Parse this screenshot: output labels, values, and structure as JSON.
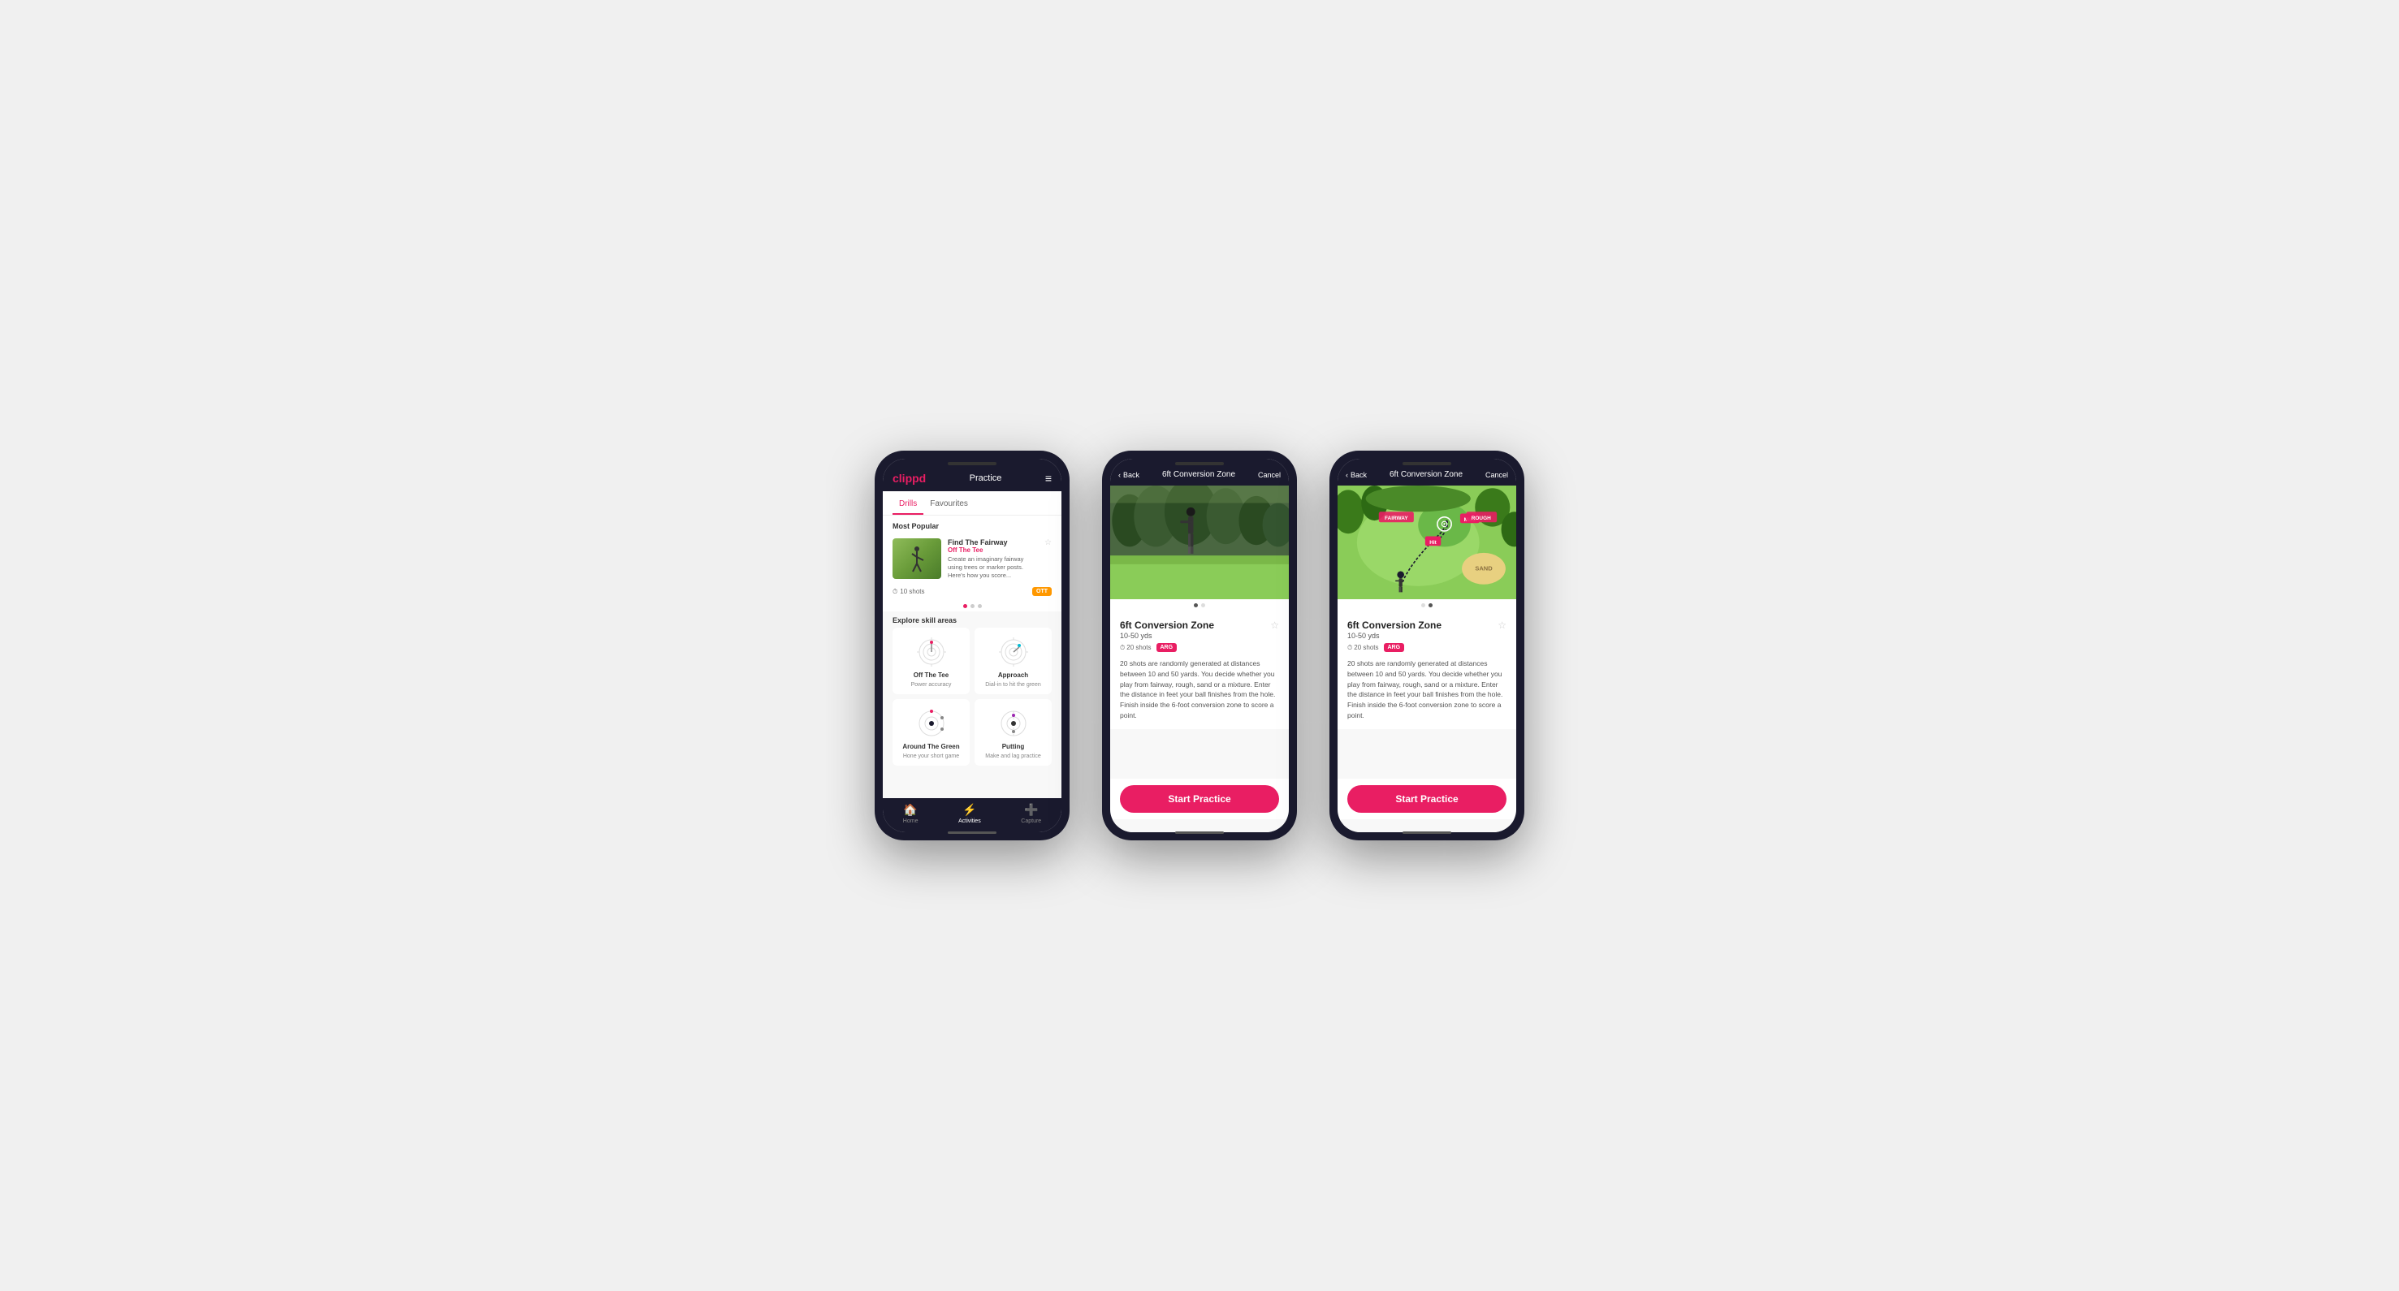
{
  "phones": [
    {
      "id": "phone1",
      "type": "practice-list",
      "header": {
        "logo": "clippd",
        "title": "Practice",
        "menu_icon": "≡"
      },
      "tabs": [
        {
          "label": "Drills",
          "active": true
        },
        {
          "label": "Favourites",
          "active": false
        }
      ],
      "most_popular_title": "Most Popular",
      "featured_drill": {
        "title": "Find The Fairway",
        "subtitle": "Off The Tee",
        "description": "Create an imaginary fairway using trees or marker posts. Here's how you score...",
        "shots": "10 shots",
        "badge": "OTT"
      },
      "dots": [
        {
          "active": true
        },
        {
          "active": false
        },
        {
          "active": false
        }
      ],
      "explore_title": "Explore skill areas",
      "skill_areas": [
        {
          "name": "Off The Tee",
          "desc": "Power accuracy",
          "icon": "ott"
        },
        {
          "name": "Approach",
          "desc": "Dial-in to hit the green",
          "icon": "approach"
        },
        {
          "name": "Around The Green",
          "desc": "Hone your short game",
          "icon": "arg"
        },
        {
          "name": "Putting",
          "desc": "Make and lag practice",
          "icon": "putting"
        }
      ],
      "bottom_nav": [
        {
          "label": "Home",
          "icon": "🏠",
          "active": false
        },
        {
          "label": "Activities",
          "icon": "⚡",
          "active": true
        },
        {
          "label": "Capture",
          "icon": "➕",
          "active": false
        }
      ]
    },
    {
      "id": "phone2",
      "type": "drill-detail-photo",
      "header": {
        "back_label": "< Back",
        "title": "6ft Conversion Zone",
        "cancel_label": "Cancel"
      },
      "image_type": "photo",
      "drill": {
        "name": "6ft Conversion Zone",
        "range": "10-50 yds",
        "shots": "20 shots",
        "badge": "ARG",
        "description": "20 shots are randomly generated at distances between 10 and 50 yards. You decide whether you play from fairway, rough, sand or a mixture. Enter the distance in feet your ball finishes from the hole. Finish inside the 6-foot conversion zone to score a point."
      },
      "img_dots": [
        {
          "active": true
        },
        {
          "active": false
        }
      ],
      "start_button_label": "Start Practice"
    },
    {
      "id": "phone3",
      "type": "drill-detail-map",
      "header": {
        "back_label": "< Back",
        "title": "6ft Conversion Zone",
        "cancel_label": "Cancel"
      },
      "image_type": "map",
      "drill": {
        "name": "6ft Conversion Zone",
        "range": "10-50 yds",
        "shots": "20 shots",
        "badge": "ARG",
        "description": "20 shots are randomly generated at distances between 10 and 50 yards. You decide whether you play from fairway, rough, sand or a mixture. Enter the distance in feet your ball finishes from the hole. Finish inside the 6-foot conversion zone to score a point."
      },
      "img_dots": [
        {
          "active": false
        },
        {
          "active": true
        }
      ],
      "start_button_label": "Start Practice"
    }
  ]
}
